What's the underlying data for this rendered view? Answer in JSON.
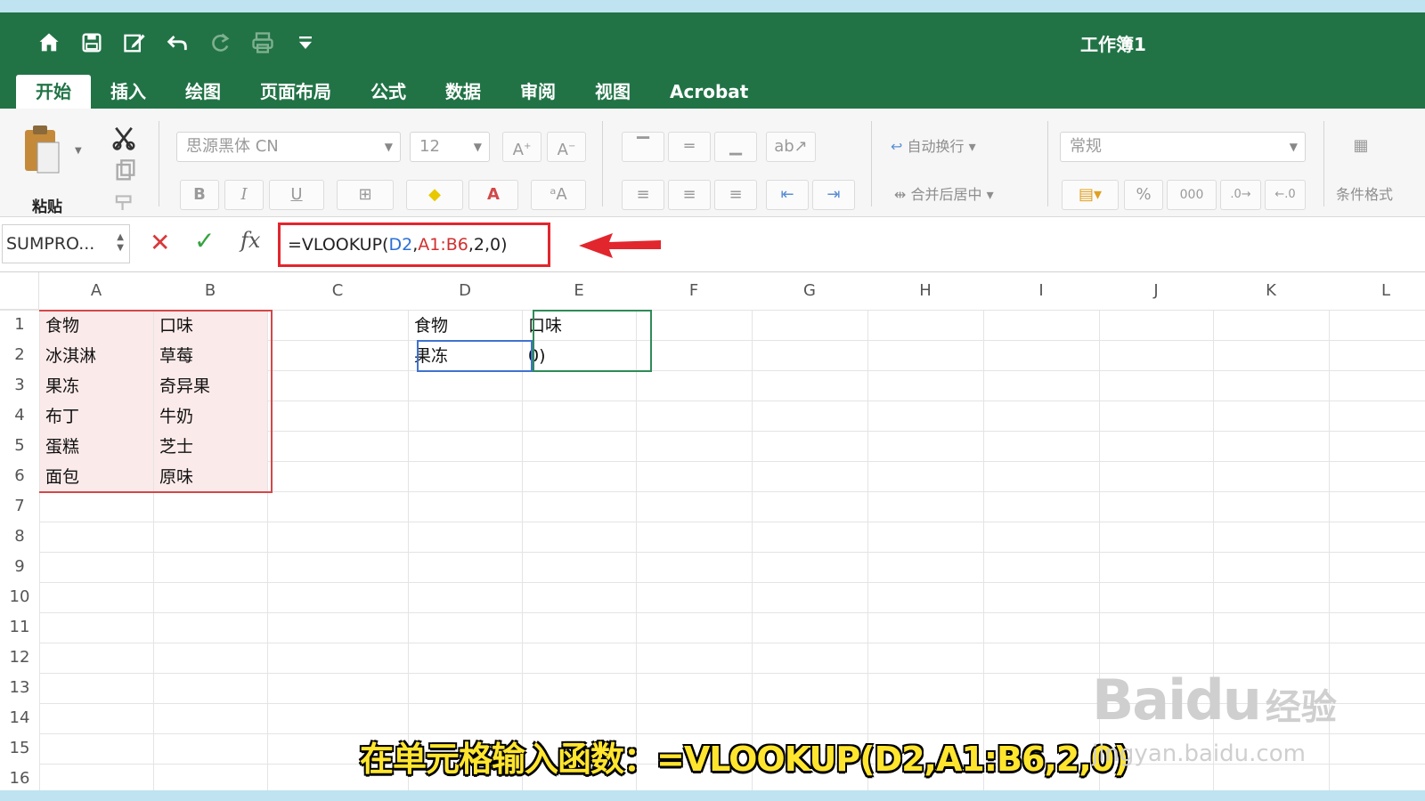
{
  "window": {
    "title": "工作簿1"
  },
  "quick_access": [
    "home-icon",
    "save-icon",
    "edit-icon",
    "undo-icon",
    "redo-icon",
    "print-icon",
    "customize-icon"
  ],
  "tabs": [
    {
      "label": "开始",
      "active": true
    },
    {
      "label": "插入"
    },
    {
      "label": "绘图"
    },
    {
      "label": "页面布局"
    },
    {
      "label": "公式"
    },
    {
      "label": "数据"
    },
    {
      "label": "审阅"
    },
    {
      "label": "视图"
    },
    {
      "label": "Acrobat"
    }
  ],
  "ribbon": {
    "paste_label": "粘贴",
    "font_name": "思源黑体 CN",
    "font_size": "12",
    "bold": "B",
    "italic": "I",
    "underline": "U",
    "wrap_text": "自动换行",
    "merge_center": "合并后居中",
    "number_format": "常规",
    "conditional_format": "条件格式"
  },
  "formula_bar": {
    "name_box": "SUMPRO...",
    "formula_prefix": "=VLOOKUP(",
    "ref_d2": "D2",
    "sep1": ",",
    "ref_range": "A1:B6",
    "formula_suffix": ",2,0)",
    "fx": "fx"
  },
  "columns": [
    "A",
    "B",
    "C",
    "D",
    "E",
    "F",
    "G",
    "H",
    "I",
    "J",
    "K",
    "L"
  ],
  "rows": [
    "1",
    "2",
    "3",
    "4",
    "5",
    "6",
    "7",
    "8",
    "9",
    "10",
    "11",
    "12",
    "13",
    "14",
    "15",
    "16"
  ],
  "cells": {
    "A1": "食物",
    "B1": "口味",
    "A2": "冰淇淋",
    "B2": "草莓",
    "A3": "果冻",
    "B3": "奇异果",
    "A4": "布丁",
    "B4": "牛奶",
    "A5": "蛋糕",
    "B5": "芝士",
    "A6": "面包",
    "B6": "原味",
    "D1": "食物",
    "E1": "口味",
    "D2": "果冻",
    "E2": "0)"
  },
  "caption": "在单元格输入函数：=VLOOKUP(D2,A1:B6,2,0)",
  "watermark": {
    "logo": "Baidu",
    "cn": "经验",
    "url": "jingyan.baidu.com"
  },
  "colors": {
    "ribbon_green": "#217346",
    "highlight_red": "#e2262d",
    "ref_blue": "#2b6fd6",
    "caption_yellow": "#ffe52e"
  }
}
